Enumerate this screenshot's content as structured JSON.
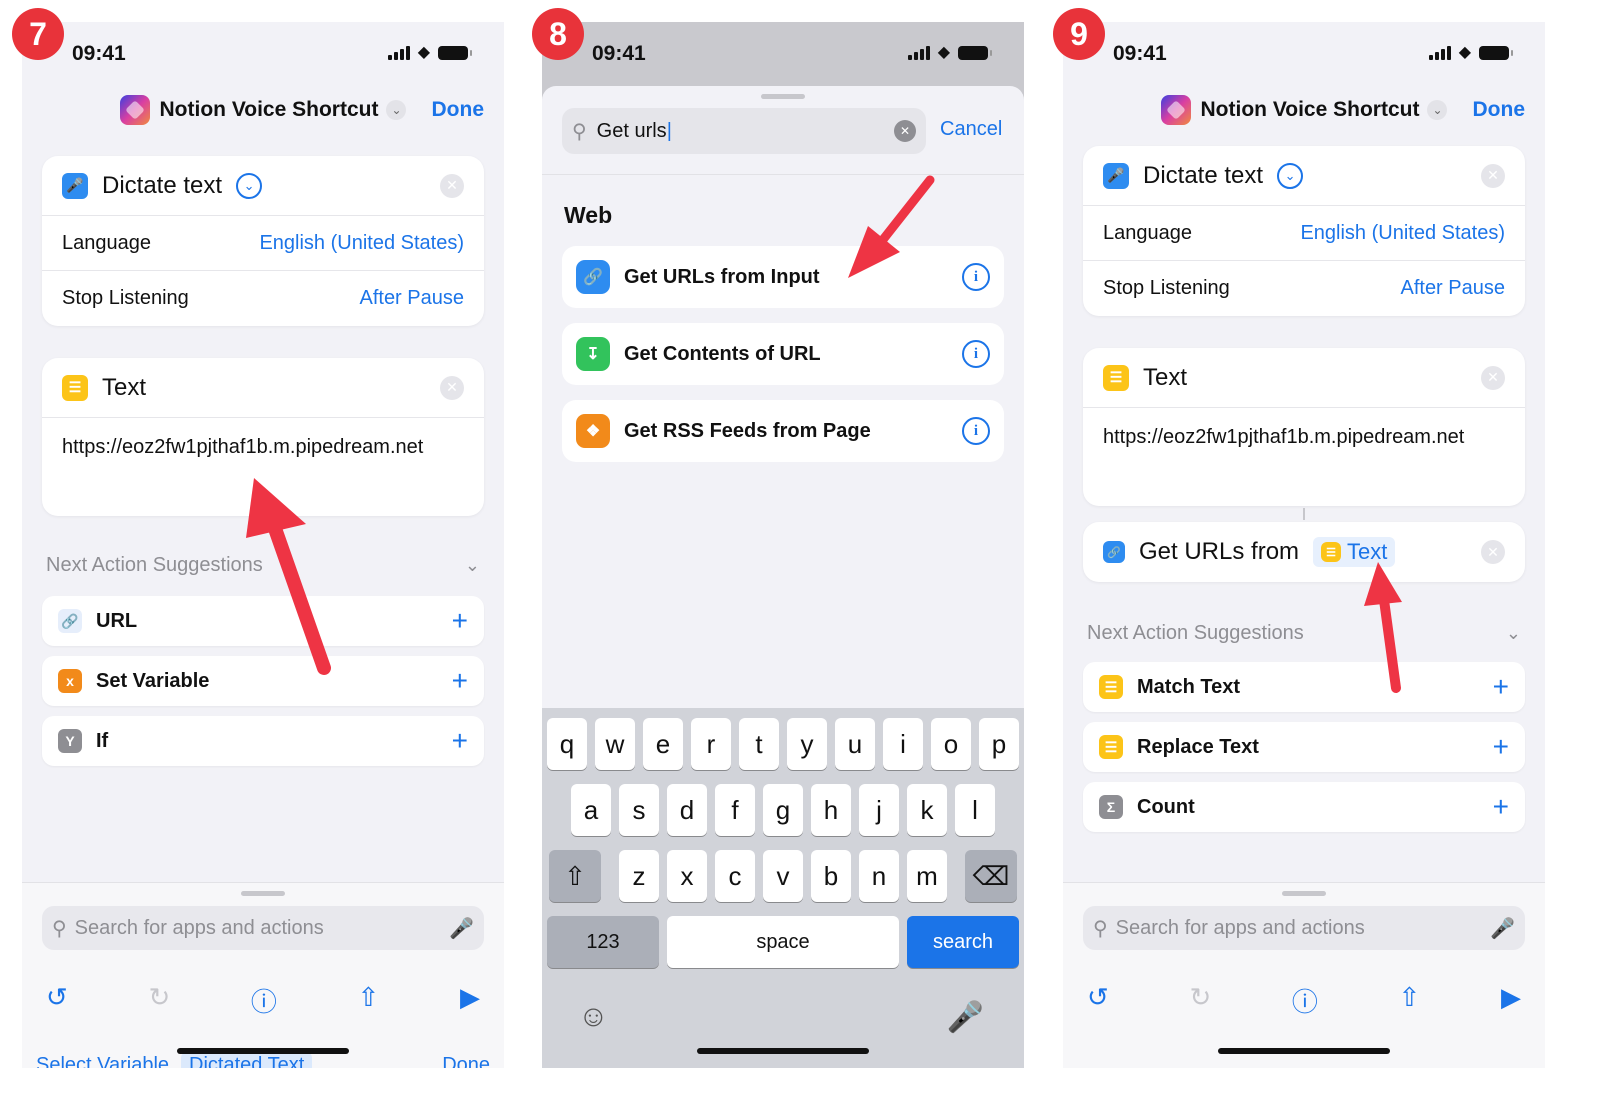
{
  "steps": [
    "7",
    "8",
    "9"
  ],
  "status": {
    "time": "09:41"
  },
  "p1": {
    "nav_title": "Notion Voice Shortcut",
    "done": "Done",
    "dictate": {
      "title": "Dictate text",
      "language_label": "Language",
      "language_value": "English (United States)",
      "stop_label": "Stop Listening",
      "stop_value": "After Pause"
    },
    "text_card": {
      "title": "Text",
      "url": "https://eoz2fw1pjthaf1b.m.pipedream.net"
    },
    "suggestions_header": "Next Action Suggestions",
    "suggestions": [
      {
        "label": "URL",
        "icon": "link-icon"
      },
      {
        "label": "Set Variable",
        "icon": "variable-icon"
      },
      {
        "label": "If",
        "icon": "branch-icon"
      }
    ],
    "search_placeholder": "Search for apps and actions",
    "peek": {
      "select_variable": "Select Variable",
      "dictated_text": "Dictated Text",
      "done": "Done"
    }
  },
  "p2": {
    "search_value": "Get urls",
    "cancel": "Cancel",
    "section": "Web",
    "results": [
      {
        "label": "Get URLs from Input",
        "icon": "link-icon"
      },
      {
        "label": "Get Contents of URL",
        "icon": "download-icon"
      },
      {
        "label": "Get RSS Feeds from Page",
        "icon": "rss-icon"
      }
    ],
    "keyboard": {
      "row1": [
        "q",
        "w",
        "e",
        "r",
        "t",
        "y",
        "u",
        "i",
        "o",
        "p"
      ],
      "row2": [
        "a",
        "s",
        "d",
        "f",
        "g",
        "h",
        "j",
        "k",
        "l"
      ],
      "row3": [
        "z",
        "x",
        "c",
        "v",
        "b",
        "n",
        "m"
      ],
      "num": "123",
      "space": "space",
      "go": "search"
    }
  },
  "p3": {
    "nav_title": "Notion Voice Shortcut",
    "done": "Done",
    "dictate": {
      "title": "Dictate text",
      "language_label": "Language",
      "language_value": "English (United States)",
      "stop_label": "Stop Listening",
      "stop_value": "After Pause"
    },
    "text_card": {
      "title": "Text",
      "url": "https://eoz2fw1pjthaf1b.m.pipedream.net"
    },
    "get_urls": {
      "label": "Get URLs from",
      "chip": "Text"
    },
    "suggestions_header": "Next Action Suggestions",
    "suggestions": [
      {
        "label": "Match Text",
        "icon": "text-icon"
      },
      {
        "label": "Replace Text",
        "icon": "text-icon"
      },
      {
        "label": "Count",
        "icon": "sigma-icon"
      }
    ],
    "search_placeholder": "Search for apps and actions"
  },
  "colors": {
    "accent": "#1b74e8",
    "step_badge": "#e8333a",
    "arrow": "#ee3444"
  }
}
